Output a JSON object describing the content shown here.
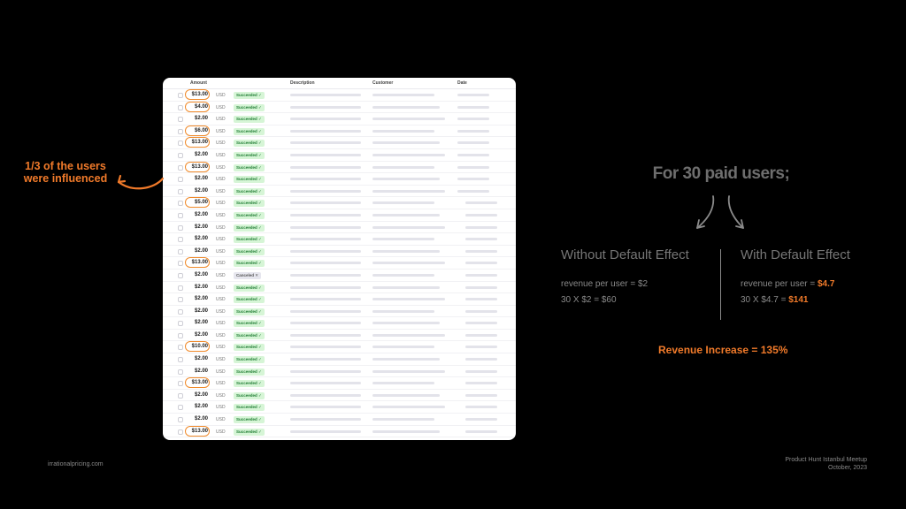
{
  "table": {
    "headers": {
      "amount": "Amount",
      "description": "Description",
      "customer": "Customer",
      "date": "Date"
    },
    "rows": [
      {
        "amount": "$13.00",
        "currency": "USD",
        "status": "Succeeded ✓",
        "highlighted": true
      },
      {
        "amount": "$4.00",
        "currency": "USD",
        "status": "Succeeded ✓",
        "highlighted": true
      },
      {
        "amount": "$2.00",
        "currency": "USD",
        "status": "Succeeded ✓",
        "highlighted": false
      },
      {
        "amount": "$6.00",
        "currency": "USD",
        "status": "Succeeded ✓",
        "highlighted": true
      },
      {
        "amount": "$13.00",
        "currency": "USD",
        "status": "Succeeded ✓",
        "highlighted": true
      },
      {
        "amount": "$2.00",
        "currency": "USD",
        "status": "Succeeded ✓",
        "highlighted": false
      },
      {
        "amount": "$13.00",
        "currency": "USD",
        "status": "Succeeded ✓",
        "highlighted": true
      },
      {
        "amount": "$2.00",
        "currency": "USD",
        "status": "Succeeded ✓",
        "highlighted": false
      },
      {
        "amount": "$2.00",
        "currency": "USD",
        "status": "Succeeded ✓",
        "highlighted": false
      },
      {
        "amount": "$5.00",
        "currency": "USD",
        "status": "Succeeded ✓",
        "highlighted": true
      },
      {
        "amount": "$2.00",
        "currency": "USD",
        "status": "Succeeded ✓",
        "highlighted": false
      },
      {
        "amount": "$2.00",
        "currency": "USD",
        "status": "Succeeded ✓",
        "highlighted": false
      },
      {
        "amount": "$2.00",
        "currency": "USD",
        "status": "Succeeded ✓",
        "highlighted": false
      },
      {
        "amount": "$2.00",
        "currency": "USD",
        "status": "Succeeded ✓",
        "highlighted": false
      },
      {
        "amount": "$13.00",
        "currency": "USD",
        "status": "Succeeded ✓",
        "highlighted": true
      },
      {
        "amount": "$2.00",
        "currency": "USD",
        "status": "Canceled ✕",
        "highlighted": false,
        "canceled": true
      },
      {
        "amount": "$2.00",
        "currency": "USD",
        "status": "Succeeded ✓",
        "highlighted": false
      },
      {
        "amount": "$2.00",
        "currency": "USD",
        "status": "Succeeded ✓",
        "highlighted": false
      },
      {
        "amount": "$2.00",
        "currency": "USD",
        "status": "Succeeded ✓",
        "highlighted": false
      },
      {
        "amount": "$2.00",
        "currency": "USD",
        "status": "Succeeded ✓",
        "highlighted": false
      },
      {
        "amount": "$2.00",
        "currency": "USD",
        "status": "Succeeded ✓",
        "highlighted": false
      },
      {
        "amount": "$10.00",
        "currency": "USD",
        "status": "Succeeded ✓",
        "highlighted": true
      },
      {
        "amount": "$2.00",
        "currency": "USD",
        "status": "Succeeded ✓",
        "highlighted": false
      },
      {
        "amount": "$2.00",
        "currency": "USD",
        "status": "Succeeded ✓",
        "highlighted": false
      },
      {
        "amount": "$13.00",
        "currency": "USD",
        "status": "Succeeded ✓",
        "highlighted": true
      },
      {
        "amount": "$2.00",
        "currency": "USD",
        "status": "Succeeded ✓",
        "highlighted": false
      },
      {
        "amount": "$2.00",
        "currency": "USD",
        "status": "Succeeded ✓",
        "highlighted": false
      },
      {
        "amount": "$2.00",
        "currency": "USD",
        "status": "Succeeded ✓",
        "highlighted": false
      },
      {
        "amount": "$13.00",
        "currency": "USD",
        "status": "Succeeded ✓",
        "highlighted": true
      }
    ]
  },
  "annotation": {
    "line1": "1/3 of the users",
    "line2": "were influenced"
  },
  "headline": "For 30 paid users;",
  "without": {
    "title": "Without Default Effect",
    "revenue_label": "revenue per user = $2",
    "calc": "30 X $2 = $60"
  },
  "with": {
    "title": "With Default Effect",
    "revenue_label_prefix": "revenue per user = ",
    "revenue_value": "$4.7",
    "calc_prefix": "30 X $4.7 = ",
    "calc_value": "$141"
  },
  "increase": "Revenue Increase = 135%",
  "footer": {
    "site": "irrationalpricing.com",
    "event": "Product Hunt Istanbul Meetup",
    "date": "October, 2023"
  },
  "colors": {
    "accent": "#f07a2a",
    "background": "#000000",
    "muted": "#767676"
  }
}
